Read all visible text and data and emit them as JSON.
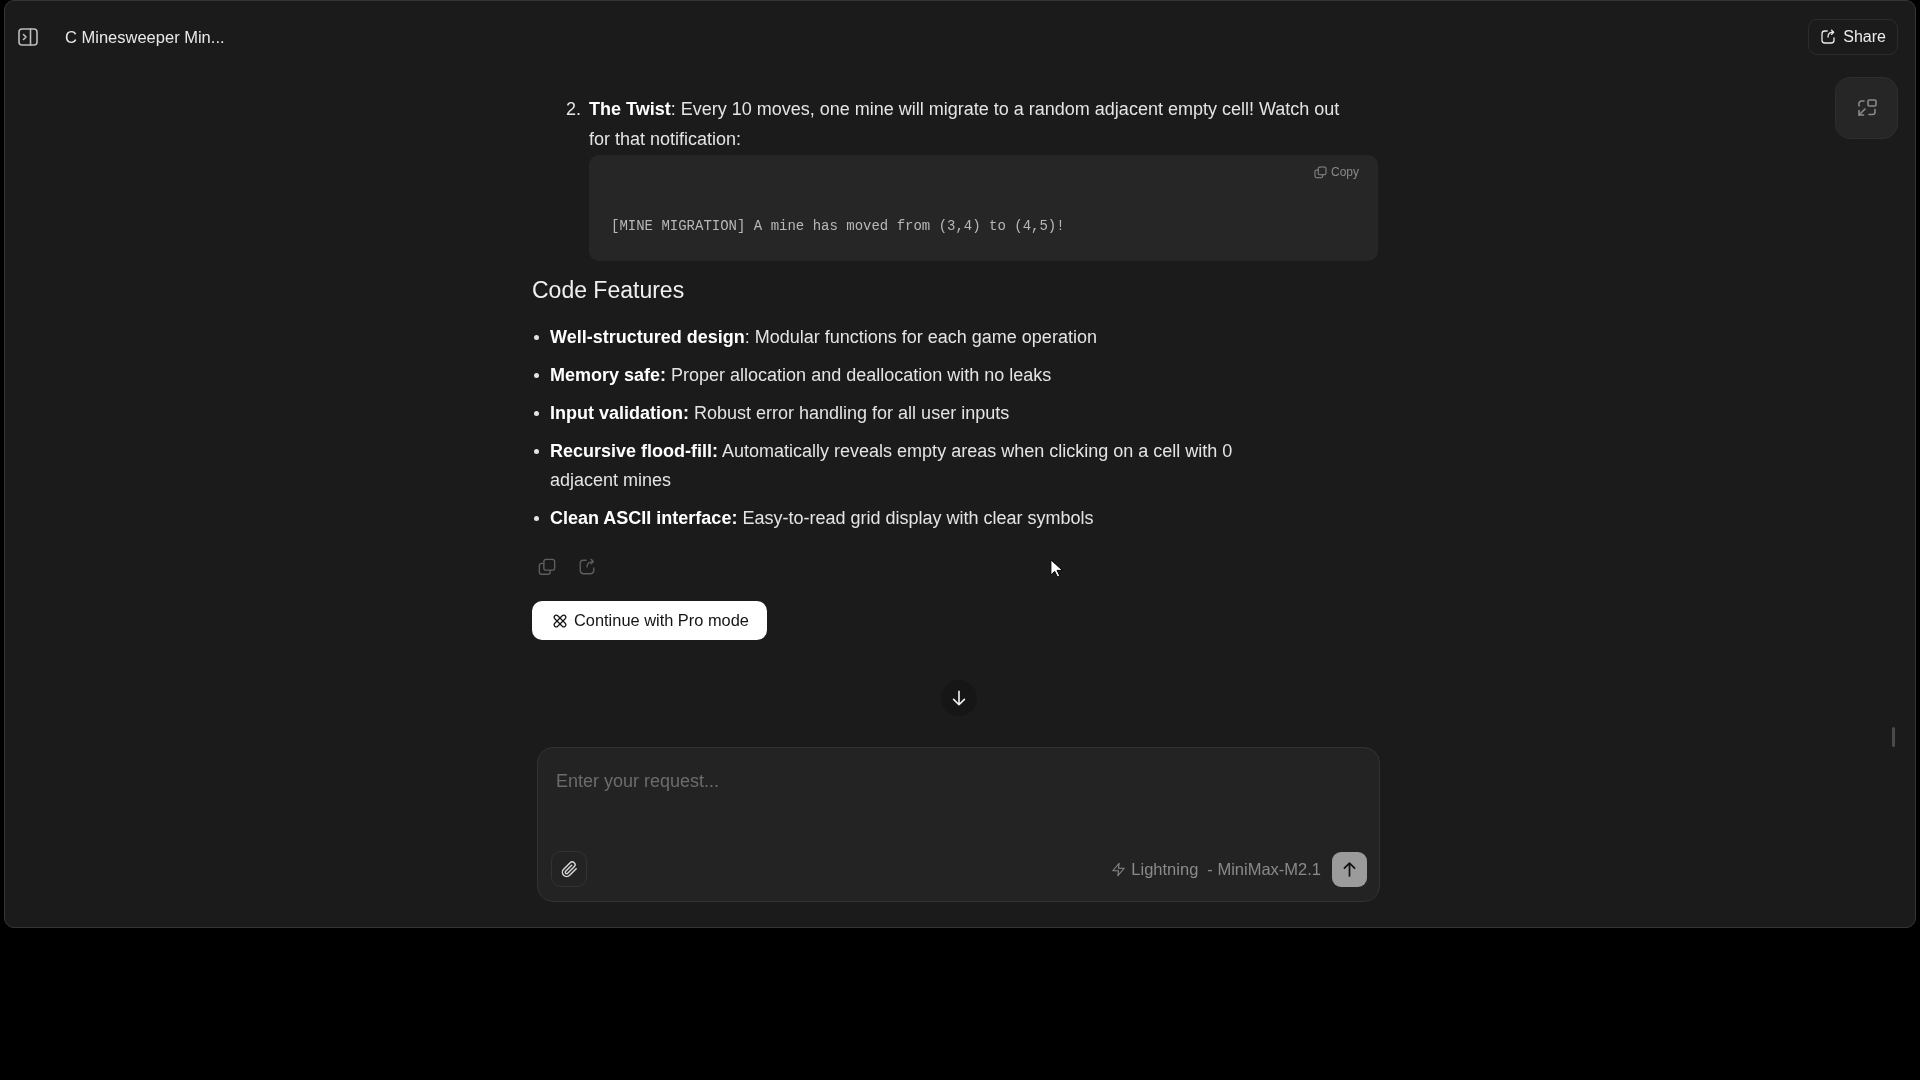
{
  "header": {
    "title": "C Minesweeper Min...",
    "share_label": "Share"
  },
  "response": {
    "numbered_items": [
      {
        "number": "2.",
        "text": "**The Twist**: Every 10 moves, one mine will migrate to a random adjacent empty cell! Watch out for that notification:",
        "code_block": {
          "copy_label": "Copy",
          "code": "[MINE MIGRATION] A mine has moved from (3,4) to (4,5)!"
        }
      }
    ],
    "sections": [
      {
        "heading": "Code Features",
        "bullets": [
          "**Well-structured design**: Modular functions for each game operation",
          "**Memory safe:** Proper allocation and deallocation with no leaks",
          "**Input validation:** Robust error handling for all user inputs",
          "**Recursive flood-fill:** Automatically reveals empty areas when clicking on a cell with 0 adjacent mines",
          "**Clean ASCII interface:** Easy-to-read grid display with clear symbols"
        ]
      }
    ]
  },
  "pro_button": {
    "label": "Continue with Pro mode"
  },
  "composer": {
    "placeholder": "Enter your request...",
    "mode": "Lightning",
    "model": "- MiniMax-M2.1"
  }
}
